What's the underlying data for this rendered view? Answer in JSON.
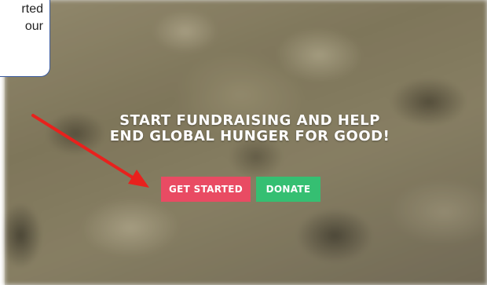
{
  "callout": {
    "line1": "rted",
    "line2": "our"
  },
  "hero": {
    "headline_line1": "START FUNDRAISING AND HELP",
    "headline_line2": "END GLOBAL HUNGER FOR GOOD!",
    "get_started_label": "GET STARTED",
    "donate_label": "DONATE"
  },
  "annotation": {
    "arrow_color": "#e8211d",
    "arrow_icon": "red-arrow-icon"
  },
  "colors": {
    "get_started": "#e94b63",
    "donate": "#35bf72"
  }
}
